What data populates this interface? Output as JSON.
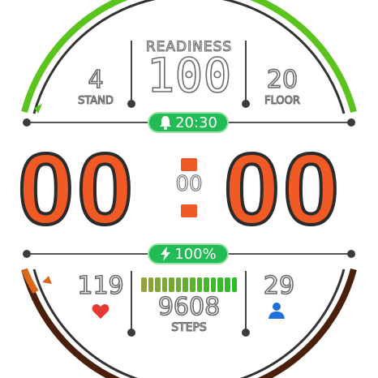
{
  "readiness": {
    "label": "READINESS",
    "value": "100"
  },
  "stand": {
    "value": "4",
    "label": "STAND"
  },
  "floor": {
    "value": "20",
    "label": "FLOOR"
  },
  "alarm": {
    "time": "20:30",
    "icon": "bell-icon"
  },
  "time": {
    "hours": "00",
    "minutes": "00",
    "seconds": "00"
  },
  "battery": {
    "percent_label": "100%",
    "percent": 100,
    "icon": "lightning-icon"
  },
  "heart": {
    "value": "119",
    "icon": "heart-icon"
  },
  "steps": {
    "value": "9608",
    "label": "STEPS",
    "bar_count": 14
  },
  "people": {
    "value": "29",
    "icon": "person-icon"
  },
  "colors": {
    "accent_green": "#5bc41c",
    "pill_green": "#22bb55",
    "digit_orange": "#f15a24",
    "arc_brown": "#4a200c",
    "heart_red": "#e53935",
    "person_blue": "#1e6fd9"
  }
}
